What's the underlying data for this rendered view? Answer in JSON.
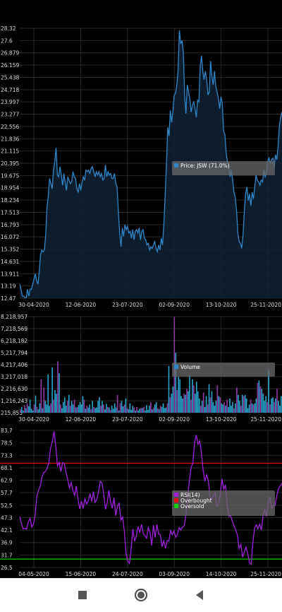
{
  "chart_data": [
    {
      "type": "area",
      "series": [
        {
          "name": "Price: JSW (71.0%)",
          "color": "#2f86c8"
        }
      ],
      "legend": {
        "placement": "right",
        "items": [
          {
            "label": "Price: JSW (71.0%)",
            "color": "#2f86c8"
          }
        ]
      },
      "y_ticks": [
        "28.32",
        "27.6",
        "26.879",
        "26.159",
        "25.438",
        "24.718",
        "23.997",
        "23.277",
        "22.556",
        "21.836",
        "21.115",
        "20.395",
        "19.675",
        "18.954",
        "18.234",
        "17.513",
        "16.793",
        "16.072",
        "15.352",
        "14.631",
        "13.911",
        "13.19",
        "12.47"
      ],
      "x_ticks": [
        "30-04-2020",
        "12-06-2020",
        "23-07-2020",
        "02-09-2020",
        "13-10-2020",
        "25-11-2020"
      ],
      "ylim": [
        12.47,
        28.32
      ],
      "grid": true,
      "values": [
        13.3,
        13.0,
        12.6,
        12.6,
        12.5,
        12.5,
        13.0,
        12.6,
        13.0,
        13.0,
        13.3,
        13.6,
        13.9,
        13.5,
        13.3,
        14.0,
        15.0,
        15.3,
        15.2,
        15.3,
        16.2,
        17.8,
        18.5,
        19.5,
        19.2,
        18.9,
        20.0,
        20.5,
        21.3,
        19.7,
        19.6,
        20.2,
        19.7,
        19.1,
        19.8,
        19.3,
        18.8,
        19.6,
        19.4,
        19.2,
        19.3,
        19.9,
        19.6,
        19.5,
        18.9,
        18.7,
        19.2,
        18.8,
        19.3,
        19.6,
        19.4,
        20.0,
        19.9,
        20.0,
        19.8,
        20.1,
        20.2,
        19.9,
        19.6,
        19.9,
        19.7,
        19.9,
        19.6,
        19.8,
        19.4,
        19.5,
        20.3,
        19.6,
        19.9,
        19.7,
        19.8,
        19.5,
        19.5,
        19.8,
        19.2,
        19.0,
        17.5,
        16.3,
        15.5,
        16.6,
        16.1,
        16.8,
        16.5,
        16.7,
        16.3,
        16.4,
        16.0,
        16.5,
        15.9,
        16.4,
        16.5,
        16.3,
        16.6,
        15.9,
        16.4,
        16.5,
        16.0,
        15.9,
        15.6,
        15.7,
        15.3,
        15.5,
        15.4,
        15.6,
        15.8,
        15.4,
        15.2,
        15.6,
        15.3,
        16.0,
        15.6,
        16.8,
        18.5,
        20.3,
        22.5,
        22.0,
        23.5,
        22.8,
        23.5,
        24.4,
        24.5,
        25.0,
        25.9,
        28.2,
        27.4,
        27.6,
        26.9,
        24.4,
        23.3,
        25.0,
        24.6,
        24.2,
        23.4,
        23.8,
        24.0,
        23.6,
        23.1,
        24.1,
        24.0,
        26.1,
        26.7,
        25.8,
        25.3,
        25.8,
        25.3,
        24.4,
        24.6,
        26.4,
        25.5,
        25.0,
        25.8,
        24.9,
        24.6,
        24.2,
        23.6,
        24.3,
        23.9,
        22.3,
        22.1,
        21.0,
        20.5,
        20.2,
        19.6,
        20.0,
        19.4,
        18.7,
        18.4,
        17.6,
        16.3,
        15.8,
        15.7,
        15.4,
        16.2,
        17.6,
        18.6,
        19.0,
        18.2,
        18.6,
        17.9,
        18.7,
        18.3,
        19.0,
        19.7,
        19.4,
        19.3,
        19.1,
        19.4,
        19.3,
        20.0,
        19.6,
        19.8,
        20.5,
        20.7,
        20.4,
        20.6,
        20.7,
        20.2,
        20.9,
        20.6,
        21.4,
        22.6,
        23.1,
        23.4
      ]
    },
    {
      "type": "bar",
      "series": [
        {
          "name": "Volume",
          "color": "#2f86c8"
        }
      ],
      "legend": {
        "placement": "right",
        "items": [
          {
            "label": "Volume",
            "color": "#2f86c8"
          }
        ]
      },
      "y_ticks": [
        "8,218,957",
        "7,218,569",
        "6,218,182",
        "5,217,794",
        "4,217,406",
        "3,217,018",
        "2,216,630",
        "1,216,243",
        "215,855"
      ],
      "x_ticks": [
        "30-04-2020",
        "12-06-2020",
        "23-07-2020",
        "02-09-2020",
        "13-10-2020",
        "25-11-2020"
      ],
      "ylim": [
        215855,
        8218957
      ],
      "grid": true,
      "bar_colors": [
        "#2aa0c8",
        "#8a3aa0"
      ],
      "values": [
        500000,
        700000,
        400000,
        850000,
        600000,
        1000000,
        750000,
        1300000,
        550000,
        400000,
        900000,
        1650000,
        700000,
        500000,
        1000000,
        3000000,
        600000,
        2300000,
        1200000,
        900000,
        3400000,
        800000,
        1000000,
        4000000,
        1300000,
        2100000,
        1800000,
        4500000,
        3500000,
        900000,
        600000,
        1100000,
        1500000,
        800000,
        1200000,
        1700000,
        800000,
        1200000,
        900000,
        1300000,
        650000,
        700000,
        850000,
        1100000,
        900000,
        1600000,
        1300000,
        550000,
        800000,
        650000,
        900000,
        500000,
        1200000,
        700000,
        600000,
        650000,
        1200000,
        1500000,
        800000,
        1200000,
        900000,
        500000,
        950000,
        700000,
        650000,
        450000,
        800000,
        550000,
        1000000,
        650000,
        1700000,
        400000,
        1000000,
        1200000,
        750000,
        900000,
        1400000,
        600000,
        500000,
        1000000,
        450000,
        800000,
        650000,
        400000,
        700000,
        400000,
        550000,
        600000,
        600000,
        700000,
        400000,
        850000,
        450000,
        800000,
        1100000,
        500000,
        650000,
        900000,
        1100000,
        600000,
        500000,
        800000,
        700000,
        1000000,
        600000,
        650000,
        1000000,
        4100000,
        1500000,
        1800000,
        2400000,
        8200000,
        5200000,
        2100000,
        3200000,
        3000000,
        1600000,
        1400000,
        1800000,
        1700000,
        2200000,
        2000000,
        3300000,
        1300000,
        3000000,
        2500000,
        1800000,
        2800000,
        2000000,
        1400000,
        800000,
        1200000,
        1900000,
        700000,
        1600000,
        900000,
        2600000,
        1500000,
        2000000,
        1100000,
        800000,
        1200000,
        2500000,
        1600000,
        1500000,
        1000000,
        900000,
        1100000,
        800000,
        1300000,
        700000,
        1400000,
        800000,
        1100000,
        600000,
        1000000,
        2300000,
        1700000,
        1200000,
        800000,
        1700000,
        1600000,
        1700000,
        1400000,
        600000,
        900000,
        1300000,
        1000000,
        900000,
        1000000,
        1400000,
        2700000,
        2900000,
        2400000,
        2200000,
        1800000,
        1200000,
        1600000,
        1100000,
        3800000,
        900000,
        1400000,
        1500000,
        1100000,
        1400000,
        2200000,
        1200000,
        800000,
        1600000
      ]
    },
    {
      "type": "line",
      "series": [
        {
          "name": "RSI(14)",
          "color": "#a020e0"
        },
        {
          "name": "Overbought",
          "color": "#e01010"
        },
        {
          "name": "Oversold",
          "color": "#10d010"
        }
      ],
      "legend": {
        "placement": "right",
        "items": [
          {
            "label": "RSI(14)",
            "color": "#a020e0"
          },
          {
            "label": "Overbought",
            "color": "#e01010"
          },
          {
            "label": "Oversold",
            "color": "#10d010"
          }
        ]
      },
      "y_ticks": [
        "83.7",
        "78.5",
        "73.3",
        "68.1",
        "62.9",
        "57.7",
        "52.5",
        "47.3",
        "42.1",
        "36.9",
        "31.7",
        "26.5"
      ],
      "x_ticks": [
        "04-05-2020",
        "15-06-2020",
        "24-07-2020",
        "03-09-2020",
        "14-10-2020",
        "25-11-2020"
      ],
      "ylim": [
        26.5,
        83.7
      ],
      "grid": true,
      "overbought": 70,
      "oversold": 30,
      "values": [
        47.8,
        44.8,
        42.6,
        42.8,
        42.5,
        45.5,
        47.0,
        43.4,
        44.6,
        48.5,
        56.5,
        58.7,
        60.7,
        64.3,
        66.1,
        66.6,
        67.8,
        70.4,
        76.3,
        79.0,
        83.3,
        77.5,
        68.9,
        70.4,
        66.5,
        70.3,
        69.7,
        66.2,
        63.1,
        59.7,
        62.0,
        58.7,
        56.6,
        60.5,
        54.9,
        51.0,
        54.1,
        51.1,
        55.1,
        53.0,
        54.3,
        57.3,
        54.0,
        58.2,
        53.6,
        55.0,
        58.3,
        62.4,
        61.8,
        57.2,
        50.8,
        53.4,
        58.7,
        54.0,
        51.2,
        55.6,
        48.2,
        52.0,
        53.3,
        46.2,
        47.6,
        41.9,
        32.3,
        29.1,
        28.2,
        34.5,
        42.5,
        37.4,
        39.6,
        43.6,
        41.0,
        44.5,
        40.8,
        39.8,
        38.7,
        43.1,
        41.2,
        35.7,
        44.2,
        39.0,
        44.5,
        40.4,
        40.3,
        35.2,
        37.6,
        34.4,
        37.7,
        37.5,
        41.9,
        40.2,
        41.8,
        39.1,
        40.3,
        43.1,
        42.1,
        43.4,
        44.0,
        48.7,
        56.8,
        62.6,
        68.4,
        70.0,
        78.7,
        81.8,
        77.9,
        79.3,
        74.4,
        67.0,
        62.5,
        65.1,
        62.8,
        56.0,
        54.8,
        56.6,
        57.5,
        52.1,
        52.8,
        57.3,
        63.4,
        59.1,
        61.0,
        53.1,
        47.8,
        48.3,
        45.7,
        43.8,
        42.3,
        39.9,
        34.4,
        36.1,
        30.8,
        33.0,
        35.0,
        32.4,
        28.5,
        27.8,
        36.9,
        43.1,
        44.3,
        42.6,
        44.6,
        42.1,
        48.5,
        50.6,
        47.8,
        53.7,
        55.9,
        51.1,
        52.5,
        52.4,
        56.6,
        59.4,
        60.6,
        61.6
      ]
    }
  ],
  "navbar": {
    "buttons": [
      "recents-icon",
      "home-icon",
      "back-icon"
    ]
  }
}
